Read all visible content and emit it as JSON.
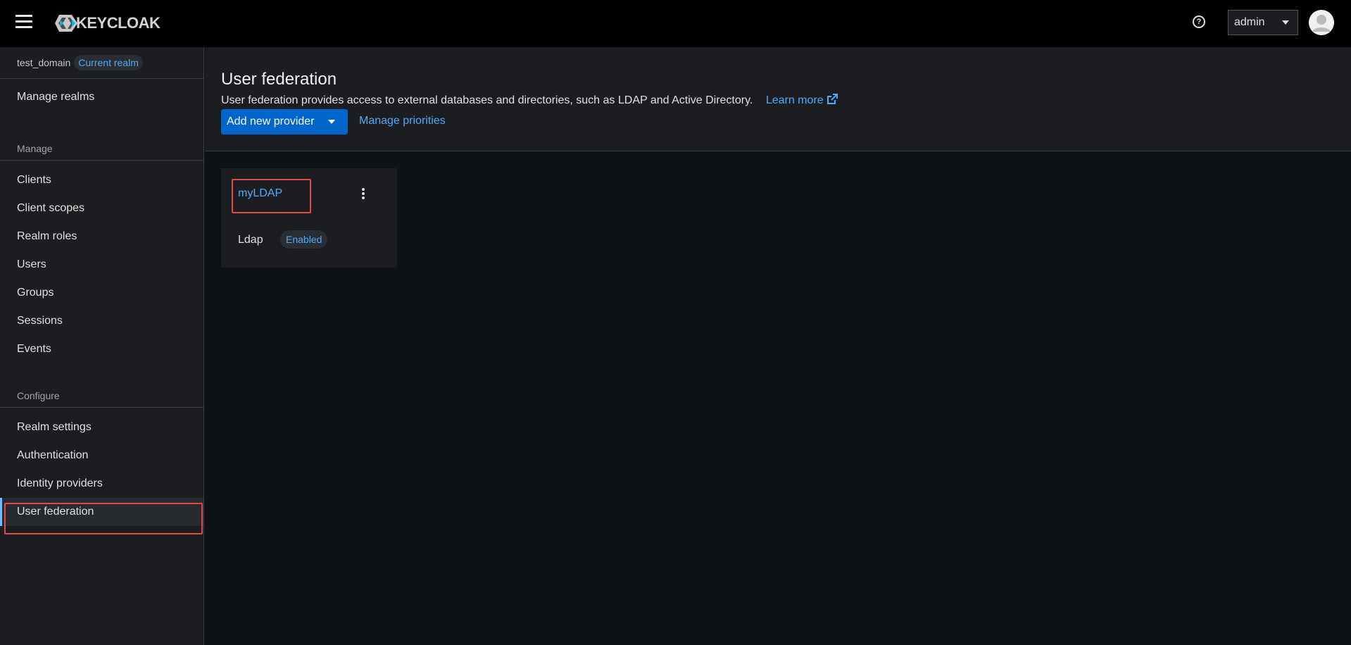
{
  "header": {
    "logo_text": "KEYCLOAK",
    "user_menu_label": "admin"
  },
  "sidebar": {
    "realm_name": "test_domain",
    "realm_badge": "Current realm",
    "manage_realms": "Manage realms",
    "manage_section": "Manage",
    "manage_items": [
      "Clients",
      "Client scopes",
      "Realm roles",
      "Users",
      "Groups",
      "Sessions",
      "Events"
    ],
    "configure_section": "Configure",
    "configure_items": [
      "Realm settings",
      "Authentication",
      "Identity providers",
      "User federation"
    ],
    "active_item": "User federation"
  },
  "main": {
    "title": "User federation",
    "description": "User federation provides access to external databases and directories, such as LDAP and Active Directory.",
    "learn_more": "Learn more",
    "add_provider_label": "Add new provider",
    "manage_priorities_label": "Manage priorities"
  },
  "providers": [
    {
      "name": "myLDAP",
      "type": "Ldap",
      "status": "Enabled"
    }
  ],
  "colors": {
    "link": "#4dabf7",
    "primary_button": "#0066cc",
    "highlight": "#e0484a",
    "active_indicator": "#73bcf7"
  }
}
